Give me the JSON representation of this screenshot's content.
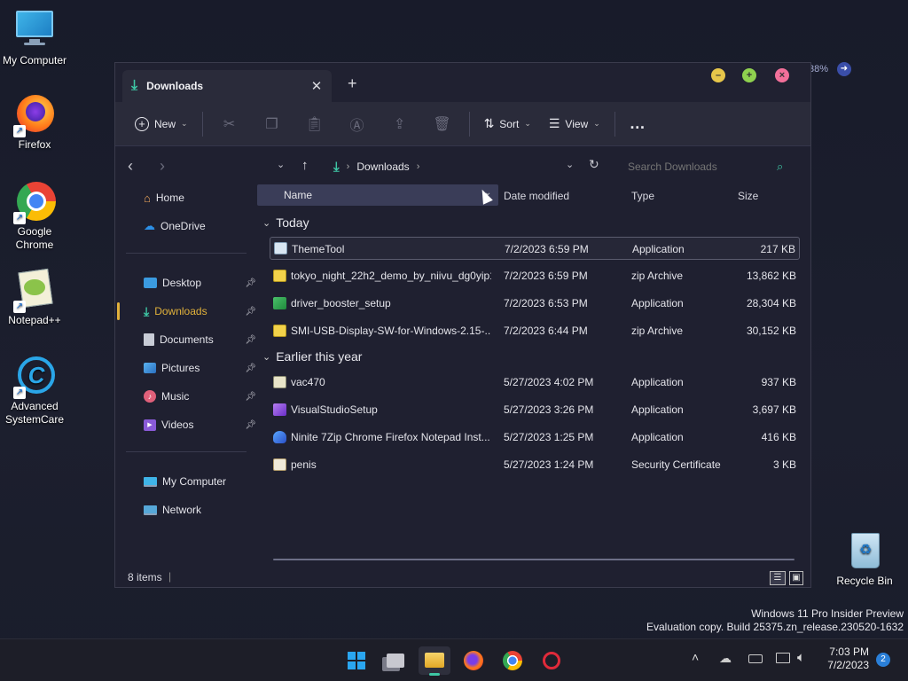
{
  "desktop": {
    "icons": [
      {
        "label": "My Computer",
        "icon": "monitor-icon"
      },
      {
        "label": "Firefox",
        "icon": "firefox-icon"
      },
      {
        "label": "Google Chrome",
        "icon": "chrome-icon"
      },
      {
        "label": "Notepad++",
        "icon": "notepadpp-icon"
      },
      {
        "label": "Advanced SystemCare",
        "icon": "systemcare-icon"
      },
      {
        "label": "Recycle Bin",
        "icon": "recycle-bin-icon"
      }
    ],
    "watermark_line1": "Windows 11 Pro Insider Preview",
    "watermark_line2": "Evaluation copy. Build 25375.zn_release.230520-1632",
    "overlay_percent": "38%"
  },
  "window": {
    "tab_title": "Downloads",
    "toolbar": {
      "new_label": "New",
      "sort_label": "Sort",
      "view_label": "View",
      "more_label": "…"
    },
    "breadcrumb": "Downloads",
    "search_placeholder": "Search Downloads",
    "sidebar": {
      "home": "Home",
      "onedrive": "OneDrive",
      "desktop": "Desktop",
      "downloads": "Downloads",
      "documents": "Documents",
      "pictures": "Pictures",
      "music": "Music",
      "videos": "Videos",
      "mycomputer": "My Computer",
      "network": "Network"
    },
    "columns": {
      "name": "Name",
      "date": "Date modified",
      "type": "Type",
      "size": "Size"
    },
    "groups": {
      "today": "Today",
      "earlier": "Earlier this year"
    },
    "files": [
      {
        "name": "ThemeTool",
        "date": "7/2/2023 6:59 PM",
        "type": "Application",
        "size": "217 KB"
      },
      {
        "name": "tokyo_night_22h2_demo_by_niivu_dg0yip1",
        "date": "7/2/2023 6:59 PM",
        "type": "zip Archive",
        "size": "13,862 KB"
      },
      {
        "name": "driver_booster_setup",
        "date": "7/2/2023 6:53 PM",
        "type": "Application",
        "size": "28,304 KB"
      },
      {
        "name": "SMI-USB-Display-SW-for-Windows-2.15-...",
        "date": "7/2/2023 6:44 PM",
        "type": "zip Archive",
        "size": "30,152 KB"
      },
      {
        "name": "vac470",
        "date": "5/27/2023 4:02 PM",
        "type": "Application",
        "size": "937 KB"
      },
      {
        "name": "VisualStudioSetup",
        "date": "5/27/2023 3:26 PM",
        "type": "Application",
        "size": "3,697 KB"
      },
      {
        "name": "Ninite 7Zip Chrome Firefox Notepad Inst...",
        "date": "5/27/2023 1:25 PM",
        "type": "Application",
        "size": "416 KB"
      },
      {
        "name": "penis",
        "date": "5/27/2023 1:24 PM",
        "type": "Security Certificate",
        "size": "3 KB"
      }
    ],
    "status_count": "8 items",
    "status_sep": "|"
  },
  "taskbar": {
    "time": "7:03 PM",
    "date": "7/2/2023",
    "notification_count": "2"
  },
  "colors": {
    "accent_green": "#3ec7a5",
    "accent_yellow": "#e1b13b",
    "window_bg": "#1f2030"
  }
}
